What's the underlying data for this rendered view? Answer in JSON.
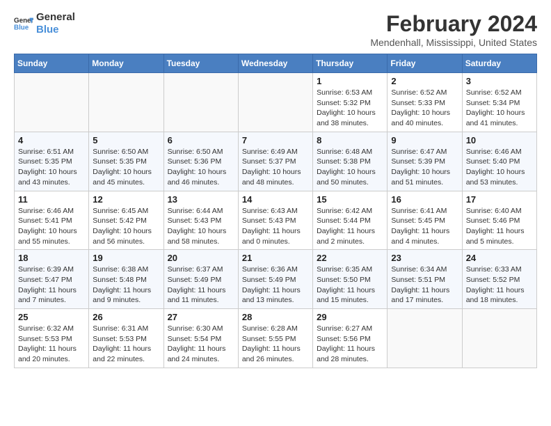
{
  "header": {
    "logo_line1": "General",
    "logo_line2": "Blue",
    "month": "February 2024",
    "location": "Mendenhall, Mississippi, United States"
  },
  "weekdays": [
    "Sunday",
    "Monday",
    "Tuesday",
    "Wednesday",
    "Thursday",
    "Friday",
    "Saturday"
  ],
  "weeks": [
    [
      {
        "day": "",
        "detail": ""
      },
      {
        "day": "",
        "detail": ""
      },
      {
        "day": "",
        "detail": ""
      },
      {
        "day": "",
        "detail": ""
      },
      {
        "day": "1",
        "detail": "Sunrise: 6:53 AM\nSunset: 5:32 PM\nDaylight: 10 hours\nand 38 minutes."
      },
      {
        "day": "2",
        "detail": "Sunrise: 6:52 AM\nSunset: 5:33 PM\nDaylight: 10 hours\nand 40 minutes."
      },
      {
        "day": "3",
        "detail": "Sunrise: 6:52 AM\nSunset: 5:34 PM\nDaylight: 10 hours\nand 41 minutes."
      }
    ],
    [
      {
        "day": "4",
        "detail": "Sunrise: 6:51 AM\nSunset: 5:35 PM\nDaylight: 10 hours\nand 43 minutes."
      },
      {
        "day": "5",
        "detail": "Sunrise: 6:50 AM\nSunset: 5:35 PM\nDaylight: 10 hours\nand 45 minutes."
      },
      {
        "day": "6",
        "detail": "Sunrise: 6:50 AM\nSunset: 5:36 PM\nDaylight: 10 hours\nand 46 minutes."
      },
      {
        "day": "7",
        "detail": "Sunrise: 6:49 AM\nSunset: 5:37 PM\nDaylight: 10 hours\nand 48 minutes."
      },
      {
        "day": "8",
        "detail": "Sunrise: 6:48 AM\nSunset: 5:38 PM\nDaylight: 10 hours\nand 50 minutes."
      },
      {
        "day": "9",
        "detail": "Sunrise: 6:47 AM\nSunset: 5:39 PM\nDaylight: 10 hours\nand 51 minutes."
      },
      {
        "day": "10",
        "detail": "Sunrise: 6:46 AM\nSunset: 5:40 PM\nDaylight: 10 hours\nand 53 minutes."
      }
    ],
    [
      {
        "day": "11",
        "detail": "Sunrise: 6:46 AM\nSunset: 5:41 PM\nDaylight: 10 hours\nand 55 minutes."
      },
      {
        "day": "12",
        "detail": "Sunrise: 6:45 AM\nSunset: 5:42 PM\nDaylight: 10 hours\nand 56 minutes."
      },
      {
        "day": "13",
        "detail": "Sunrise: 6:44 AM\nSunset: 5:43 PM\nDaylight: 10 hours\nand 58 minutes."
      },
      {
        "day": "14",
        "detail": "Sunrise: 6:43 AM\nSunset: 5:43 PM\nDaylight: 11 hours\nand 0 minutes."
      },
      {
        "day": "15",
        "detail": "Sunrise: 6:42 AM\nSunset: 5:44 PM\nDaylight: 11 hours\nand 2 minutes."
      },
      {
        "day": "16",
        "detail": "Sunrise: 6:41 AM\nSunset: 5:45 PM\nDaylight: 11 hours\nand 4 minutes."
      },
      {
        "day": "17",
        "detail": "Sunrise: 6:40 AM\nSunset: 5:46 PM\nDaylight: 11 hours\nand 5 minutes."
      }
    ],
    [
      {
        "day": "18",
        "detail": "Sunrise: 6:39 AM\nSunset: 5:47 PM\nDaylight: 11 hours\nand 7 minutes."
      },
      {
        "day": "19",
        "detail": "Sunrise: 6:38 AM\nSunset: 5:48 PM\nDaylight: 11 hours\nand 9 minutes."
      },
      {
        "day": "20",
        "detail": "Sunrise: 6:37 AM\nSunset: 5:49 PM\nDaylight: 11 hours\nand 11 minutes."
      },
      {
        "day": "21",
        "detail": "Sunrise: 6:36 AM\nSunset: 5:49 PM\nDaylight: 11 hours\nand 13 minutes."
      },
      {
        "day": "22",
        "detail": "Sunrise: 6:35 AM\nSunset: 5:50 PM\nDaylight: 11 hours\nand 15 minutes."
      },
      {
        "day": "23",
        "detail": "Sunrise: 6:34 AM\nSunset: 5:51 PM\nDaylight: 11 hours\nand 17 minutes."
      },
      {
        "day": "24",
        "detail": "Sunrise: 6:33 AM\nSunset: 5:52 PM\nDaylight: 11 hours\nand 18 minutes."
      }
    ],
    [
      {
        "day": "25",
        "detail": "Sunrise: 6:32 AM\nSunset: 5:53 PM\nDaylight: 11 hours\nand 20 minutes."
      },
      {
        "day": "26",
        "detail": "Sunrise: 6:31 AM\nSunset: 5:53 PM\nDaylight: 11 hours\nand 22 minutes."
      },
      {
        "day": "27",
        "detail": "Sunrise: 6:30 AM\nSunset: 5:54 PM\nDaylight: 11 hours\nand 24 minutes."
      },
      {
        "day": "28",
        "detail": "Sunrise: 6:28 AM\nSunset: 5:55 PM\nDaylight: 11 hours\nand 26 minutes."
      },
      {
        "day": "29",
        "detail": "Sunrise: 6:27 AM\nSunset: 5:56 PM\nDaylight: 11 hours\nand 28 minutes."
      },
      {
        "day": "",
        "detail": ""
      },
      {
        "day": "",
        "detail": ""
      }
    ]
  ]
}
